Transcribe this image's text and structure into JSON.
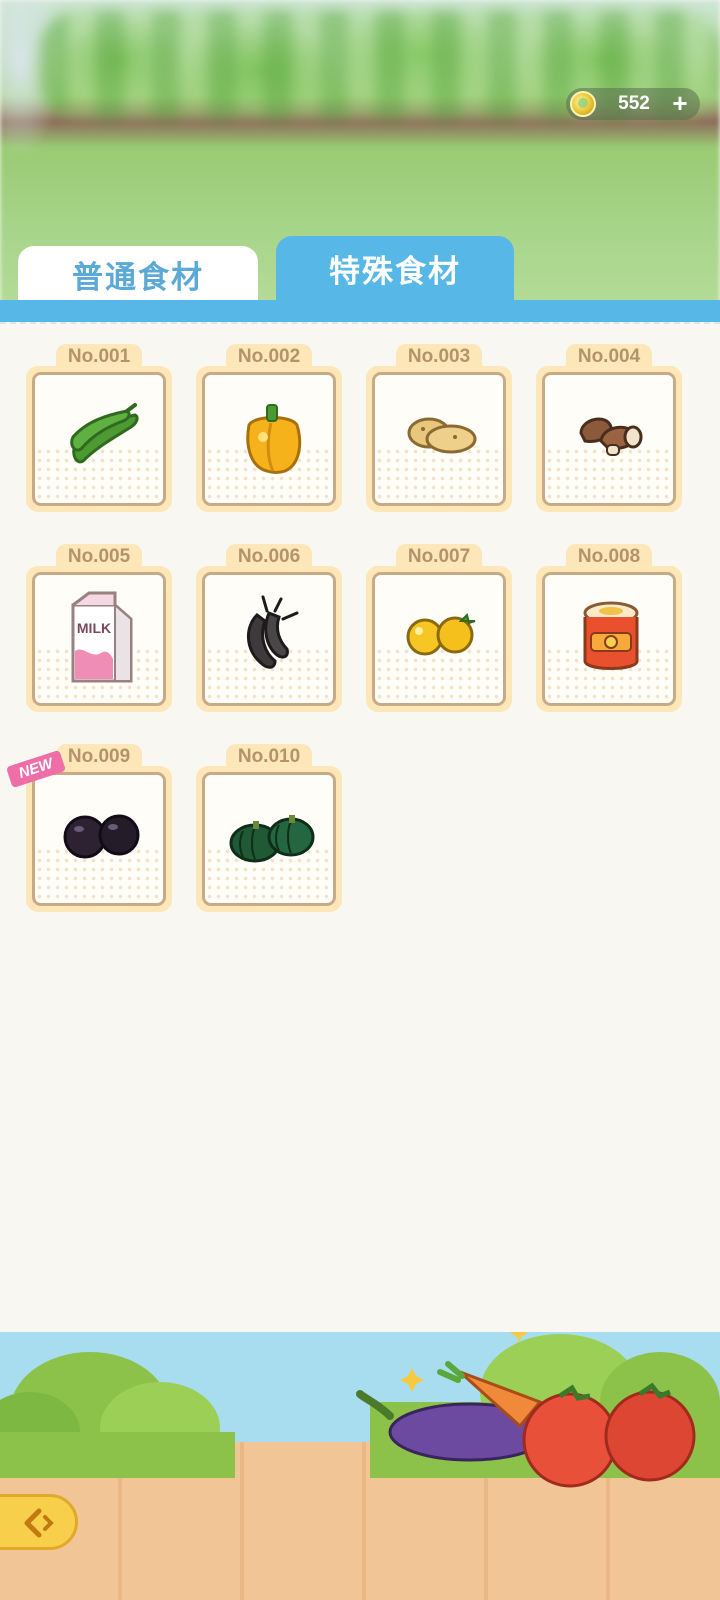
{
  "currency": {
    "icon": "rainbow-coin-icon",
    "value": "552",
    "add_label": "+"
  },
  "tabs": [
    {
      "label": "普通食材",
      "active": false
    },
    {
      "label": "特殊食材",
      "active": true
    }
  ],
  "items": [
    {
      "label": "No.001",
      "icon": "green-pepper-icon",
      "new": false
    },
    {
      "label": "No.002",
      "icon": "yellow-bell-pepper-icon",
      "new": false
    },
    {
      "label": "No.003",
      "icon": "potato-icon",
      "new": false
    },
    {
      "label": "No.004",
      "icon": "mushroom-icon",
      "new": false
    },
    {
      "label": "No.005",
      "icon": "milk-carton-icon",
      "new": false,
      "text": "MILK"
    },
    {
      "label": "No.006",
      "icon": "shrimp-icon",
      "new": false
    },
    {
      "label": "No.007",
      "icon": "yellow-tomato-icon",
      "new": false
    },
    {
      "label": "No.008",
      "icon": "jam-jar-icon",
      "new": false
    },
    {
      "label": "No.009",
      "icon": "eggplant-icon",
      "new": true
    },
    {
      "label": "No.010",
      "icon": "pumpkin-icon",
      "new": false
    }
  ],
  "new_badge": "NEW",
  "colors": {
    "tab_blue": "#57b7e6",
    "card_frame": "#fde6b8",
    "label_brown": "#b4936b",
    "new_pink": "#ef6ea8"
  },
  "back_button": {
    "icon": "back-arrow-icon"
  }
}
